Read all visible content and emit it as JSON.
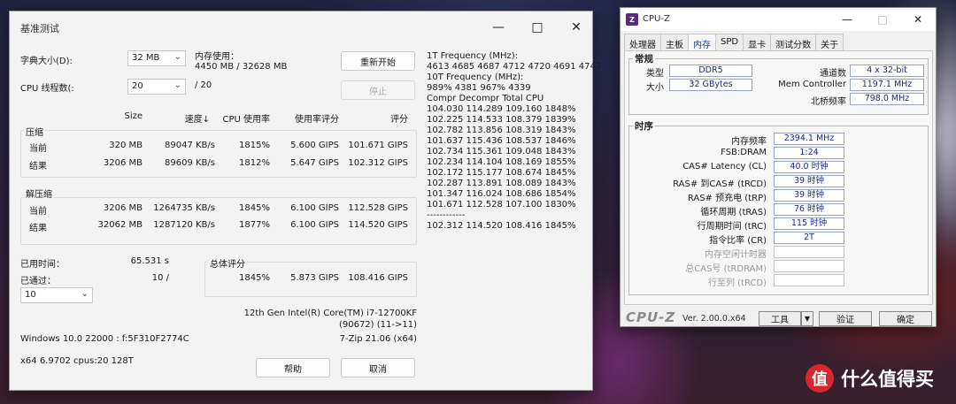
{
  "zip": {
    "title": "基准测试",
    "dict_label": "字典大小(D):",
    "dict_value": "32 MB",
    "mem_label": "内存使用：",
    "mem_value": "4450 MB / 32628 MB",
    "restart": "重新开始",
    "threads_label": "CPU 线程数(:",
    "threads_value": "20",
    "threads_total": "/ 20",
    "stop": "停止",
    "headers": {
      "size": "Size",
      "speed": "速度↓",
      "cpu": "CPU 使用率",
      "rating_per_usage": "使用率评分",
      "rating": "评分"
    },
    "compress": {
      "label": "压缩",
      "current": {
        "name": "当前",
        "size": "320 MB",
        "speed": "89047 KB/s",
        "cpu": "1815%",
        "rpu": "5.600 GIPS",
        "rating": "101.671 GIPS"
      },
      "result": {
        "name": "结果",
        "size": "3206 MB",
        "speed": "89609 KB/s",
        "cpu": "1812%",
        "rpu": "5.647 GIPS",
        "rating": "102.312 GIPS"
      }
    },
    "decompress": {
      "label": "解压缩",
      "current": {
        "name": "当前",
        "size": "3206 MB",
        "speed": "1264735 KB/s",
        "cpu": "1845%",
        "rpu": "6.100 GIPS",
        "rating": "112.528 GIPS"
      },
      "result": {
        "name": "结果",
        "size": "32062 MB",
        "speed": "1287120 KB/s",
        "cpu": "1877%",
        "rpu": "6.100 GIPS",
        "rating": "114.520 GIPS"
      }
    },
    "elapsed_label": "已用时间：",
    "elapsed_value": "65.531 s",
    "passed_label": "已通过：",
    "passed_value": "10 /",
    "passes_value": "10",
    "total_label": "总体评分",
    "total": {
      "cpu": "1845%",
      "rpu": "5.873 GIPS",
      "rating": "108.416 GIPS"
    },
    "cpu_name": "12th Gen Intel(R) Core(TM) i7-12700KF",
    "cpu_id": "(90672) (11->11)",
    "os": "Windows 10.0 22000 : f:5F310F2774C",
    "zip_ver": "7-Zip 21.06 (x64)",
    "arch": "x64 6.9702 cpus:20 128T",
    "help": "帮助",
    "cancel": "取消",
    "freq1_label": "1T Frequency (MHz):",
    "freq1_values": "4613 4685 4687 4712 4720 4691 4743",
    "freq10_label": "10T Frequency (MHz):",
    "freq10_values": "989% 4381 967% 4339",
    "log_header": "Compr Decompr Total   CPU",
    "log_rows": [
      "104.030  114.289  109.160  1848%",
      "102.225  114.533  108.379  1839%",
      "102.782  113.856  108.319  1843%",
      "101.637  115.436  108.537  1846%",
      "102.734  115.361  109.048  1843%",
      "102.234  114.104  108.169  1855%",
      "102.172  115.177  108.674  1845%",
      "102.287  113.891  108.089  1843%",
      "101.347  116.024  108.686  1854%",
      "101.671  112.528  107.100  1830%"
    ],
    "log_sep": "------------",
    "log_final": "102.312  114.520  108.416  1845%"
  },
  "cpuz": {
    "title": "CPU-Z",
    "tabs": [
      "处理器",
      "主板",
      "内存",
      "SPD",
      "显卡",
      "测试分数",
      "关于"
    ],
    "general": {
      "label": "常规",
      "type_label": "类型",
      "type_value": "DDR5",
      "size_label": "大小",
      "size_value": "32 GBytes",
      "channels_label": "通道数",
      "channels_value": "4 x 32-bit",
      "memctrl_label": "Mem Controller",
      "memctrl_value": "1197.1 MHz",
      "nb_label": "北桥频率",
      "nb_value": "798.0 MHz"
    },
    "timings": {
      "label": "时序",
      "rows": [
        {
          "label": "内存频率",
          "value": "2394.1 MHz"
        },
        {
          "label": "FSB:DRAM",
          "value": "1:24"
        },
        {
          "label": "CAS# Latency (CL)",
          "value": "40.0 时钟"
        },
        {
          "label": "RAS# 到CAS# (tRCD)",
          "value": "39 时钟"
        },
        {
          "label": "RAS# 预充电 (tRP)",
          "value": "39 时钟"
        },
        {
          "label": "循环周期 (tRAS)",
          "value": "76 时钟"
        },
        {
          "label": "行周期时间 (tRC)",
          "value": "115 时钟"
        },
        {
          "label": "指令比率 (CR)",
          "value": "2T"
        },
        {
          "label": "内存空闲计时器",
          "value": ""
        },
        {
          "label": "总CAS号 (tRDRAM)",
          "value": ""
        },
        {
          "label": "行至列 (tRCD)",
          "value": ""
        }
      ]
    },
    "brand": "CPU-Z",
    "version": "Ver. 2.00.0.x64",
    "tools": "工具",
    "validate": "验证",
    "ok": "确定"
  },
  "watermark": {
    "badge": "值",
    "text": "什么值得买"
  }
}
